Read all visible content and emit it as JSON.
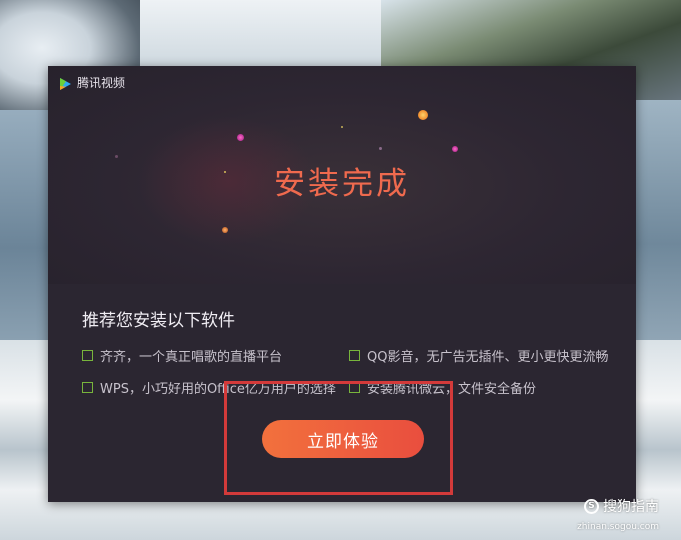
{
  "window": {
    "app_title": "腾讯视频",
    "logo_icon": "tencent-video-logo-icon"
  },
  "hero": {
    "completion_title": "安装完成",
    "title_color": "#ef6a4e"
  },
  "recommend": {
    "section_title": "推荐您安装以下软件",
    "options": [
      {
        "label": "齐齐，一个真正唱歌的直播平台",
        "checked": false
      },
      {
        "label": "QQ影音，无广告无插件、更小更快更流畅",
        "checked": false
      },
      {
        "label": "WPS，小巧好用的Office亿万用户的选择",
        "checked": false
      },
      {
        "label": "安装腾讯微云，文件安全备份",
        "checked": false
      }
    ],
    "checkbox_color": "#78b43c"
  },
  "actions": {
    "start_label": "立即体验",
    "button_colors": [
      "#f2713d",
      "#e94e3e"
    ]
  },
  "annotation": {
    "highlight_color": "#d33a3a"
  },
  "watermark": {
    "brand": "搜狗指南",
    "url": "zhinan.sogou.com",
    "icon": "sogou-s-icon"
  }
}
